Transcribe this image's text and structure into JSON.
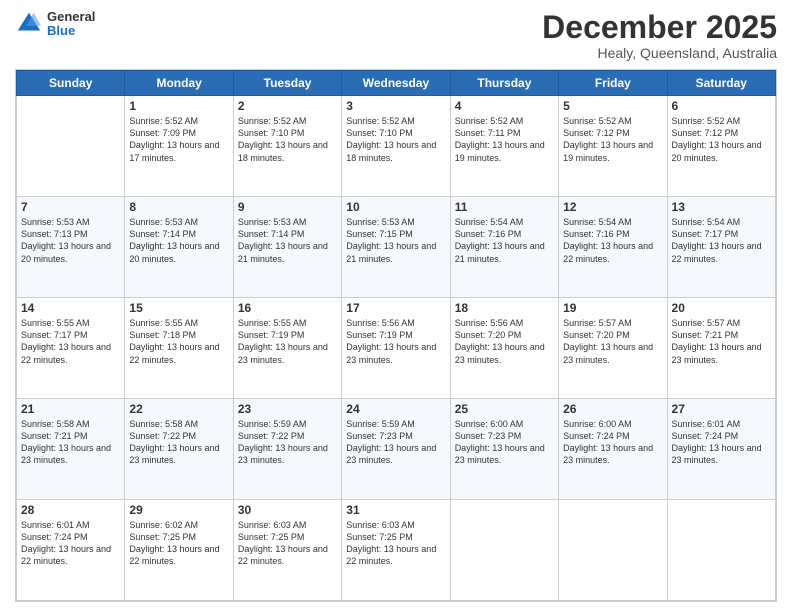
{
  "header": {
    "logo": {
      "general": "General",
      "blue": "Blue"
    },
    "title": "December 2025",
    "location": "Healy, Queensland, Australia"
  },
  "calendar": {
    "days_of_week": [
      "Sunday",
      "Monday",
      "Tuesday",
      "Wednesday",
      "Thursday",
      "Friday",
      "Saturday"
    ],
    "weeks": [
      [
        {
          "day": "",
          "info": ""
        },
        {
          "day": "1",
          "info": "Sunrise: 5:52 AM\nSunset: 7:09 PM\nDaylight: 13 hours\nand 17 minutes."
        },
        {
          "day": "2",
          "info": "Sunrise: 5:52 AM\nSunset: 7:10 PM\nDaylight: 13 hours\nand 18 minutes."
        },
        {
          "day": "3",
          "info": "Sunrise: 5:52 AM\nSunset: 7:10 PM\nDaylight: 13 hours\nand 18 minutes."
        },
        {
          "day": "4",
          "info": "Sunrise: 5:52 AM\nSunset: 7:11 PM\nDaylight: 13 hours\nand 19 minutes."
        },
        {
          "day": "5",
          "info": "Sunrise: 5:52 AM\nSunset: 7:12 PM\nDaylight: 13 hours\nand 19 minutes."
        },
        {
          "day": "6",
          "info": "Sunrise: 5:52 AM\nSunset: 7:12 PM\nDaylight: 13 hours\nand 20 minutes."
        }
      ],
      [
        {
          "day": "7",
          "info": "Sunrise: 5:53 AM\nSunset: 7:13 PM\nDaylight: 13 hours\nand 20 minutes."
        },
        {
          "day": "8",
          "info": "Sunrise: 5:53 AM\nSunset: 7:14 PM\nDaylight: 13 hours\nand 20 minutes."
        },
        {
          "day": "9",
          "info": "Sunrise: 5:53 AM\nSunset: 7:14 PM\nDaylight: 13 hours\nand 21 minutes."
        },
        {
          "day": "10",
          "info": "Sunrise: 5:53 AM\nSunset: 7:15 PM\nDaylight: 13 hours\nand 21 minutes."
        },
        {
          "day": "11",
          "info": "Sunrise: 5:54 AM\nSunset: 7:16 PM\nDaylight: 13 hours\nand 21 minutes."
        },
        {
          "day": "12",
          "info": "Sunrise: 5:54 AM\nSunset: 7:16 PM\nDaylight: 13 hours\nand 22 minutes."
        },
        {
          "day": "13",
          "info": "Sunrise: 5:54 AM\nSunset: 7:17 PM\nDaylight: 13 hours\nand 22 minutes."
        }
      ],
      [
        {
          "day": "14",
          "info": "Sunrise: 5:55 AM\nSunset: 7:17 PM\nDaylight: 13 hours\nand 22 minutes."
        },
        {
          "day": "15",
          "info": "Sunrise: 5:55 AM\nSunset: 7:18 PM\nDaylight: 13 hours\nand 22 minutes."
        },
        {
          "day": "16",
          "info": "Sunrise: 5:55 AM\nSunset: 7:19 PM\nDaylight: 13 hours\nand 23 minutes."
        },
        {
          "day": "17",
          "info": "Sunrise: 5:56 AM\nSunset: 7:19 PM\nDaylight: 13 hours\nand 23 minutes."
        },
        {
          "day": "18",
          "info": "Sunrise: 5:56 AM\nSunset: 7:20 PM\nDaylight: 13 hours\nand 23 minutes."
        },
        {
          "day": "19",
          "info": "Sunrise: 5:57 AM\nSunset: 7:20 PM\nDaylight: 13 hours\nand 23 minutes."
        },
        {
          "day": "20",
          "info": "Sunrise: 5:57 AM\nSunset: 7:21 PM\nDaylight: 13 hours\nand 23 minutes."
        }
      ],
      [
        {
          "day": "21",
          "info": "Sunrise: 5:58 AM\nSunset: 7:21 PM\nDaylight: 13 hours\nand 23 minutes."
        },
        {
          "day": "22",
          "info": "Sunrise: 5:58 AM\nSunset: 7:22 PM\nDaylight: 13 hours\nand 23 minutes."
        },
        {
          "day": "23",
          "info": "Sunrise: 5:59 AM\nSunset: 7:22 PM\nDaylight: 13 hours\nand 23 minutes."
        },
        {
          "day": "24",
          "info": "Sunrise: 5:59 AM\nSunset: 7:23 PM\nDaylight: 13 hours\nand 23 minutes."
        },
        {
          "day": "25",
          "info": "Sunrise: 6:00 AM\nSunset: 7:23 PM\nDaylight: 13 hours\nand 23 minutes."
        },
        {
          "day": "26",
          "info": "Sunrise: 6:00 AM\nSunset: 7:24 PM\nDaylight: 13 hours\nand 23 minutes."
        },
        {
          "day": "27",
          "info": "Sunrise: 6:01 AM\nSunset: 7:24 PM\nDaylight: 13 hours\nand 23 minutes."
        }
      ],
      [
        {
          "day": "28",
          "info": "Sunrise: 6:01 AM\nSunset: 7:24 PM\nDaylight: 13 hours\nand 22 minutes."
        },
        {
          "day": "29",
          "info": "Sunrise: 6:02 AM\nSunset: 7:25 PM\nDaylight: 13 hours\nand 22 minutes."
        },
        {
          "day": "30",
          "info": "Sunrise: 6:03 AM\nSunset: 7:25 PM\nDaylight: 13 hours\nand 22 minutes."
        },
        {
          "day": "31",
          "info": "Sunrise: 6:03 AM\nSunset: 7:25 PM\nDaylight: 13 hours\nand 22 minutes."
        },
        {
          "day": "",
          "info": ""
        },
        {
          "day": "",
          "info": ""
        },
        {
          "day": "",
          "info": ""
        }
      ]
    ]
  }
}
